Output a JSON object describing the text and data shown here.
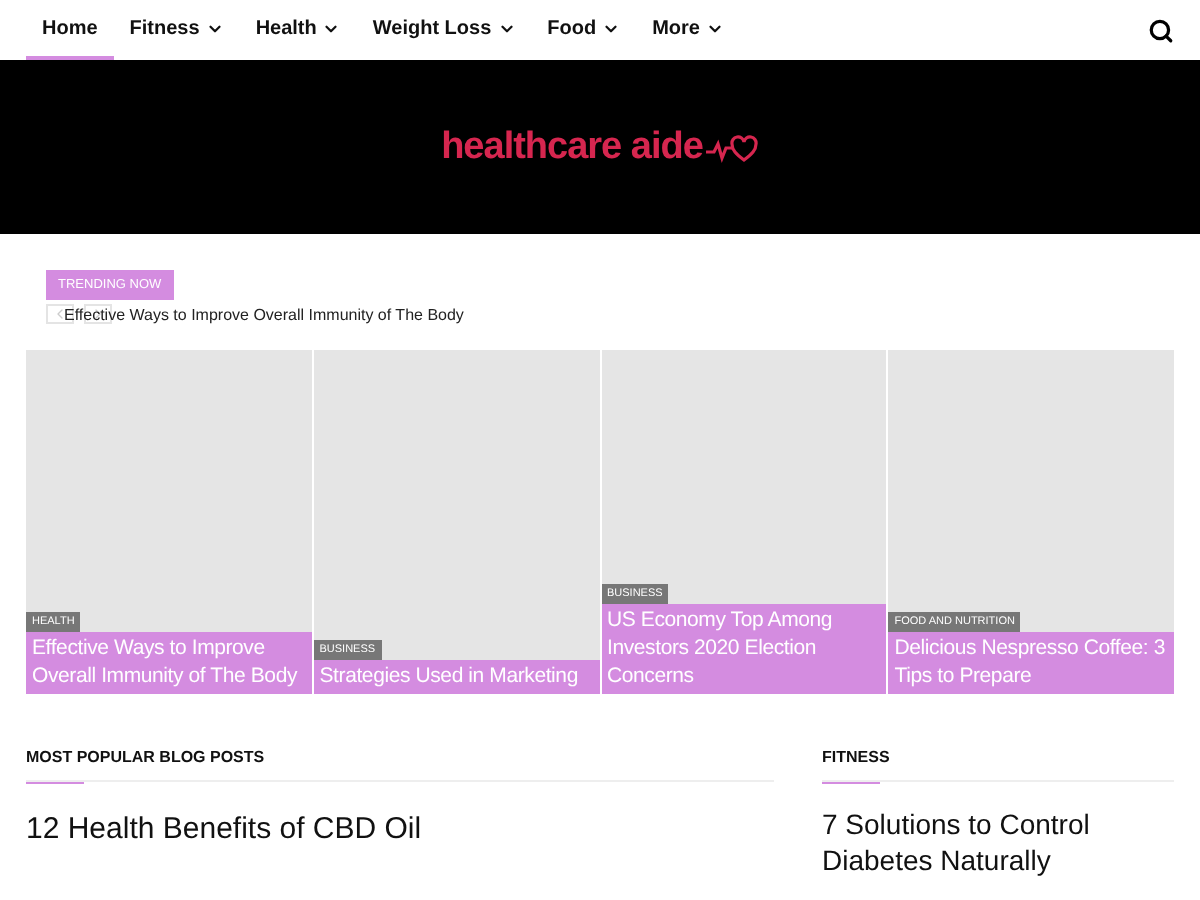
{
  "nav": {
    "items": [
      {
        "label": "Home",
        "selected": true,
        "dropdown": false
      },
      {
        "label": "Fitness",
        "selected": false,
        "dropdown": true
      },
      {
        "label": "Health",
        "selected": false,
        "dropdown": true
      },
      {
        "label": "Weight Loss",
        "selected": false,
        "dropdown": true
      },
      {
        "label": "Food",
        "selected": false,
        "dropdown": true
      },
      {
        "label": "More",
        "selected": false,
        "dropdown": true
      }
    ]
  },
  "banner": {
    "logo": "healthcare aide"
  },
  "trending": {
    "tag": "TRENDING NOW",
    "headline": "Effective Ways to Improve Overall Immunity of The Body"
  },
  "featured": [
    {
      "category": "HEALTH",
      "title": "Effective Ways to Improve Overall Immunity of The Body"
    },
    {
      "category": "BUSINESS",
      "title": "Strategies Used in Marketing"
    },
    {
      "category": "BUSINESS",
      "title": "US Economy Top Among Investors 2020 Election Concerns"
    },
    {
      "category": "FOOD AND NUTRITION",
      "title": "Delicious Nespresso Coffee: 3 Tips to Prepare"
    }
  ],
  "sections": [
    {
      "heading": "MOST POPULAR BLOG POSTS",
      "post": "12 Health Benefits of CBD Oil"
    },
    {
      "heading": "FITNESS",
      "post": "7 Solutions to Control Diabetes Naturally"
    }
  ]
}
